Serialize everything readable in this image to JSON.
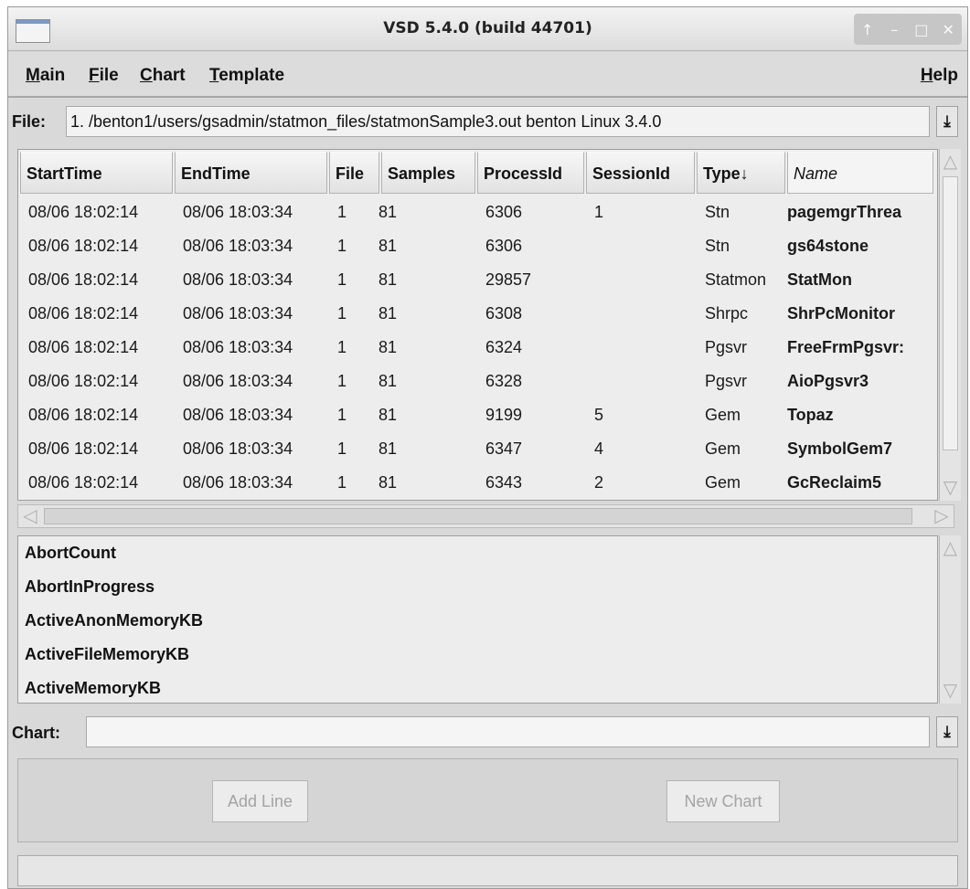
{
  "window": {
    "title": "VSD 5.4.0 (build 44701)"
  },
  "title_controls": [
    "↑",
    "–",
    "□",
    "✕"
  ],
  "menubar": {
    "main": "Main",
    "file": "File",
    "chart": "Chart",
    "template": "Template",
    "help": "Help"
  },
  "file_row": {
    "label": "File:",
    "value": "1. /benton1/users/gsadmin/statmon_files/statmonSample3.out benton Linux 3.4.0",
    "dropdown_glyph": "⤓"
  },
  "table": {
    "columns": [
      "StartTime",
      "EndTime",
      "File",
      "Samples",
      "ProcessId",
      "SessionId",
      "Type↓",
      "Name"
    ],
    "sort_column": "Type",
    "rows": [
      [
        "08/06 18:02:14",
        "08/06 18:03:34",
        "1",
        "81",
        "6306",
        "1",
        "Stn",
        "pagemgrThrea"
      ],
      [
        "08/06 18:02:14",
        "08/06 18:03:34",
        "1",
        "81",
        "6306",
        "",
        "Stn",
        "gs64stone"
      ],
      [
        "08/06 18:02:14",
        "08/06 18:03:34",
        "1",
        "81",
        "29857",
        "",
        "Statmon",
        "StatMon"
      ],
      [
        "08/06 18:02:14",
        "08/06 18:03:34",
        "1",
        "81",
        "6308",
        "",
        "Shrpc",
        "ShrPcMonitor"
      ],
      [
        "08/06 18:02:14",
        "08/06 18:03:34",
        "1",
        "81",
        "6324",
        "",
        "Pgsvr",
        "FreeFrmPgsvr:"
      ],
      [
        "08/06 18:02:14",
        "08/06 18:03:34",
        "1",
        "81",
        "6328",
        "",
        "Pgsvr",
        "AioPgsvr3"
      ],
      [
        "08/06 18:02:14",
        "08/06 18:03:34",
        "1",
        "81",
        "9199",
        "5",
        "Gem",
        "Topaz"
      ],
      [
        "08/06 18:02:14",
        "08/06 18:03:34",
        "1",
        "81",
        "6347",
        "4",
        "Gem",
        "SymbolGem7"
      ],
      [
        "08/06 18:02:14",
        "08/06 18:03:34",
        "1",
        "81",
        "6343",
        "2",
        "Gem",
        "GcReclaim5"
      ]
    ]
  },
  "stats": [
    "AbortCount",
    "AbortInProgress",
    "ActiveAnonMemoryKB",
    "ActiveFileMemoryKB",
    "ActiveMemoryKB"
  ],
  "chart_row": {
    "label": "Chart:",
    "value": "",
    "dropdown_glyph": "⤓"
  },
  "buttons": {
    "add_line": "Add Line",
    "new_chart": "New Chart"
  },
  "status": {
    "text": ""
  }
}
